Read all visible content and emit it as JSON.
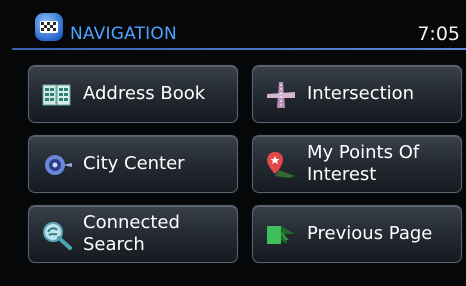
{
  "header": {
    "title": "NAVIGATION",
    "clock": "7:05",
    "logo_icon": "navigation-logo-icon"
  },
  "buttons": [
    {
      "label": "Address Book",
      "icon": "address-book-icon"
    },
    {
      "label": "Intersection",
      "icon": "intersection-icon"
    },
    {
      "label": "City Center",
      "icon": "city-center-icon"
    },
    {
      "label": "My Points Of\nInterest",
      "icon": "points-of-interest-icon"
    },
    {
      "label": "Connected\nSearch",
      "icon": "connected-search-icon"
    },
    {
      "label": "Previous Page",
      "icon": "previous-page-icon"
    }
  ],
  "colors": {
    "title": "#4fa2ff",
    "divider": "#4a79c9",
    "button_border": "#5a6370"
  }
}
